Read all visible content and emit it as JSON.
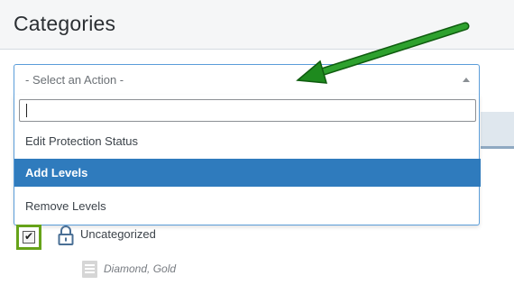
{
  "header": {
    "title": "Categories"
  },
  "action_select": {
    "selected": "- Select an Action -",
    "search_value": "",
    "options": [
      {
        "label": "Edit Protection Status",
        "highlighted": false
      },
      {
        "label": "Add Levels",
        "highlighted": true
      },
      {
        "label": "Remove Levels",
        "highlighted": false
      }
    ]
  },
  "row": {
    "checked": true,
    "name": "Uncategorized",
    "levels": [
      "Diamond",
      "Gold"
    ],
    "levels_separator": ", "
  },
  "colors": {
    "highlight": "#2f7bbd",
    "annotation_arrow": "#1e8a1e",
    "annotation_box": "#66a319"
  },
  "icons": {
    "lock": "lock-icon",
    "document": "document-icon",
    "dropdown": "chevron-up-icon"
  }
}
